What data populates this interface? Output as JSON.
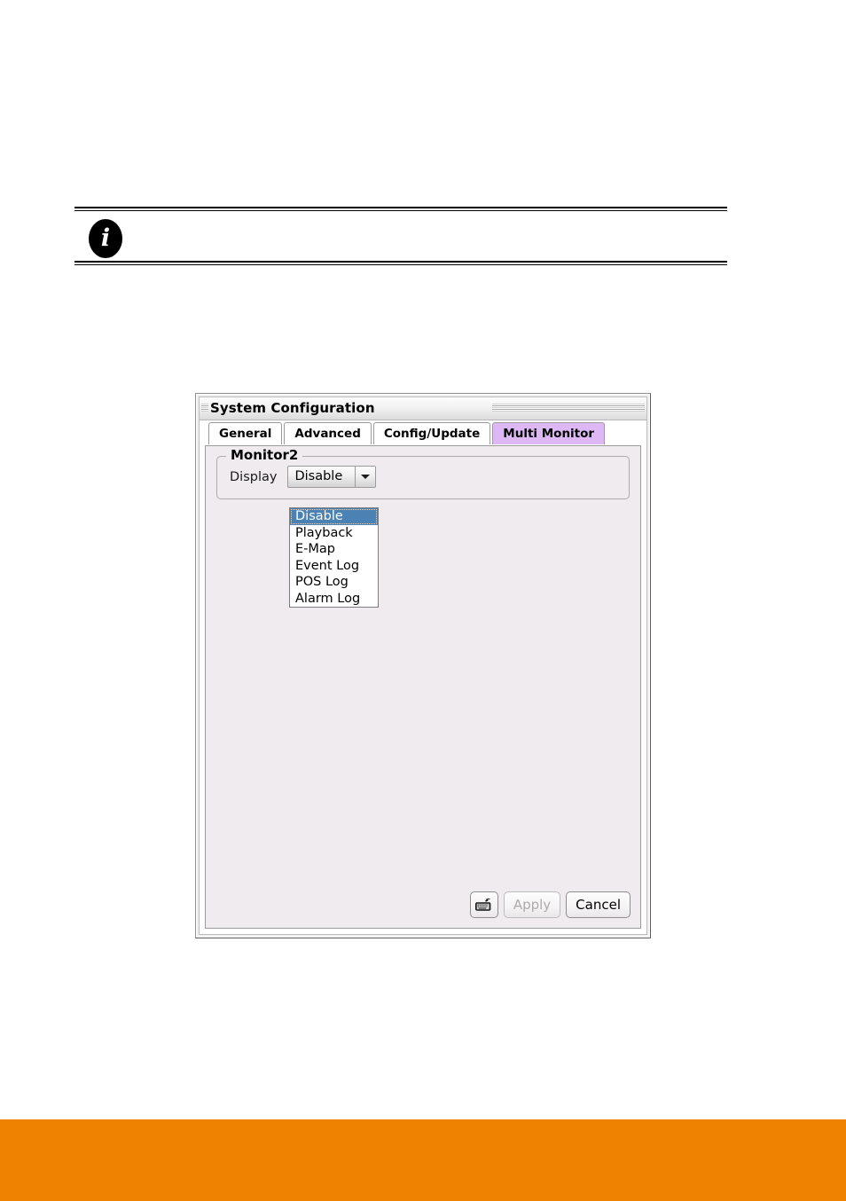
{
  "page": {
    "background_color": "#ffffff",
    "footer_band_color": "#ef8300"
  },
  "note": {
    "icon": "info-italic-i-icon",
    "icon_glyph": "i",
    "text": ""
  },
  "dialog": {
    "title": "System Configuration",
    "tabs": [
      {
        "label": "General",
        "active": false
      },
      {
        "label": "Advanced",
        "active": false
      },
      {
        "label": "Config/Update",
        "active": false
      },
      {
        "label": "Multi Monitor",
        "active": true
      }
    ],
    "active_tab_color": "#ddb8f5",
    "group": {
      "legend": "Monitor2",
      "field": {
        "label": "Display",
        "combobox": {
          "value": "Disable",
          "expanded": true,
          "options": [
            "Disable",
            "Playback",
            "E-Map",
            "Event Log",
            "POS Log",
            "Alarm Log"
          ],
          "selected_index": 0,
          "selection_color": "#4a82b4"
        }
      }
    },
    "buttons": {
      "keyboard_icon": "keyboard-icon",
      "apply_label": "Apply",
      "apply_enabled": false,
      "cancel_label": "Cancel",
      "cancel_enabled": true
    }
  }
}
